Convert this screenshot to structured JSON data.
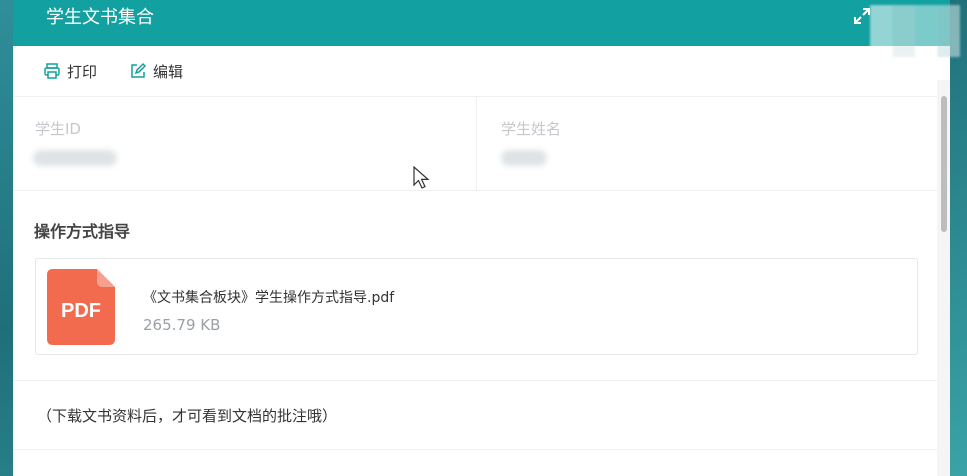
{
  "modal": {
    "title": "学生文书集合"
  },
  "toolbar": {
    "print_label": "打印",
    "edit_label": "编辑"
  },
  "info": {
    "student_id_label": "学生ID",
    "student_name_label": "学生姓名"
  },
  "guide": {
    "section_title": "操作方式指导",
    "file": {
      "name": "《文书集合板块》学生操作方式指导.pdf",
      "size": "265.79 KB",
      "icon_text": "PDF",
      "icon": "pdf-file-icon"
    }
  },
  "note": "（下载文书资料后，才可看到文档的批注哦）",
  "colors": {
    "header": "#12a0a0",
    "pdf_icon": "#f26b4f",
    "accent_icon": "#12a0a0"
  }
}
